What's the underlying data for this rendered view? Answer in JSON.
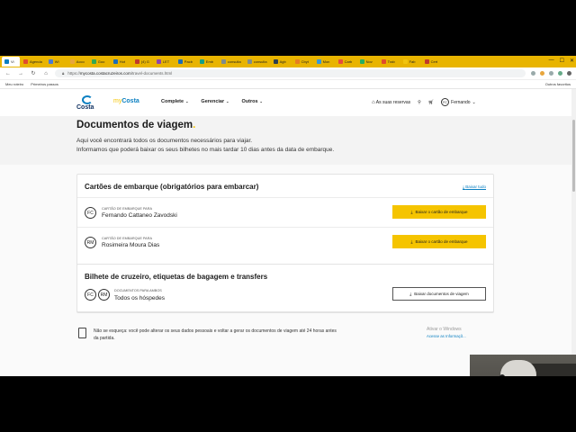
{
  "browser": {
    "tabs": [
      {
        "label": "Vi",
        "color": "#0a7fc1",
        "active": true
      },
      {
        "label": "Agenda",
        "color": "#e04b2e"
      },
      {
        "label": "Wi",
        "color": "#4a7bd6"
      },
      {
        "label": "Acco",
        "color": "#e8a63c"
      },
      {
        "label": "Goo",
        "color": "#34a853"
      },
      {
        "label": "Hot",
        "color": "#1c6db8"
      },
      {
        "label": "(4) G",
        "color": "#c0392b"
      },
      {
        "label": "LET",
        "color": "#8e44ad"
      },
      {
        "label": "Pacb",
        "color": "#1c6db8"
      },
      {
        "label": "Emb",
        "color": "#16a085"
      },
      {
        "label": "consulta",
        "color": "#7f8c8d"
      },
      {
        "label": "consulta",
        "color": "#7f8c8d"
      },
      {
        "label": "Agb",
        "color": "#2c3e50"
      },
      {
        "label": "Cbyt",
        "color": "#e67e22"
      },
      {
        "label": "Mon",
        "color": "#3498db"
      },
      {
        "label": "Carb",
        "color": "#e74c3c"
      },
      {
        "label": "Nov",
        "color": "#27ae60"
      },
      {
        "label": "Trab",
        "color": "#e04b2e"
      },
      {
        "label": "Fab",
        "color": "#f1c40f"
      },
      {
        "label": "Cert",
        "color": "#c0392b"
      }
    ],
    "url_prefix": "https://",
    "url_host": "mycosta.costacruzeiros.com",
    "url_path": "/travel-documents.html",
    "bookmarks": [
      "Meu roteiro",
      "Primeiros passos"
    ],
    "bookmarks_right": "Outros favoritos"
  },
  "header": {
    "logo_text": "Costa",
    "mycosta_prefix": "my",
    "mycosta_suffix": "Costa",
    "menu": [
      "Complete",
      "Gerenciar",
      "Outros"
    ],
    "reservations": "As suas reservas",
    "user_initials": "FC",
    "user_name": "Fernando"
  },
  "page": {
    "title": "Documentos de viagem",
    "title_dot": ".",
    "intro_line1": "Aqui você encontrará todos os documentos necessários para viajar.",
    "intro_line2": "Informamos que poderá baixar os seus bilhetes no mais tardar 10 dias antes da data de embarque."
  },
  "boarding": {
    "title": "Cartões de embarque (obrigatórios para embarcar)",
    "download_all": "Baixar tudo",
    "rows": [
      {
        "initials": "FC",
        "small": "Cartão de embarque para",
        "name": "Fernando Cattaneo Zavodski",
        "button": "Baixar o cartão de embarque"
      },
      {
        "initials": "RM",
        "small": "Cartão de embarque para",
        "name": "Rosimeira Moura Dias",
        "button": "Baixar o cartão de embarque"
      }
    ]
  },
  "ticket": {
    "title": "Bilhete de cruzeiro, etiquetas de bagagem e transfers",
    "initials": [
      "FC",
      "RM"
    ],
    "small": "Documentos para ambos",
    "name": "Todos os hóspedes",
    "button": "Baixar documentos de viagem"
  },
  "notice": {
    "line1": "Não se esqueça: você pode alterar os seus dados pessoais e voltar a gerar os documentos de viagem até 24 horas antes",
    "line2": "da partida."
  },
  "activation": {
    "line1": "Ativar o Windows",
    "line2": "Acesse as Informaçõ..."
  },
  "taskbar_colors": [
    "#c0392b",
    "#e04b2e",
    "#3b8be0",
    "#2aa0d8",
    "#f1c40f",
    "#34a853",
    "#e67e22",
    "#3b8be0",
    "#e8c84a",
    "#e8c84a",
    "#e8c84a",
    "#c8a040",
    "#d8b03a",
    "#3b8be0",
    "#e8c84a",
    "#e8c84a",
    "#e8c84a",
    "#3b8be0",
    "#d93a2b",
    "#e8c84a",
    "#e8c84a",
    "#3b8be0",
    "#c0392b",
    "#e8c84a",
    "#3b8be0",
    "#7a5af0",
    "#e8c84a",
    "#3b8be0",
    "#e04b2e",
    "#7a5af0",
    "#e8c84a",
    "#c0392b",
    "#3b8be0"
  ]
}
